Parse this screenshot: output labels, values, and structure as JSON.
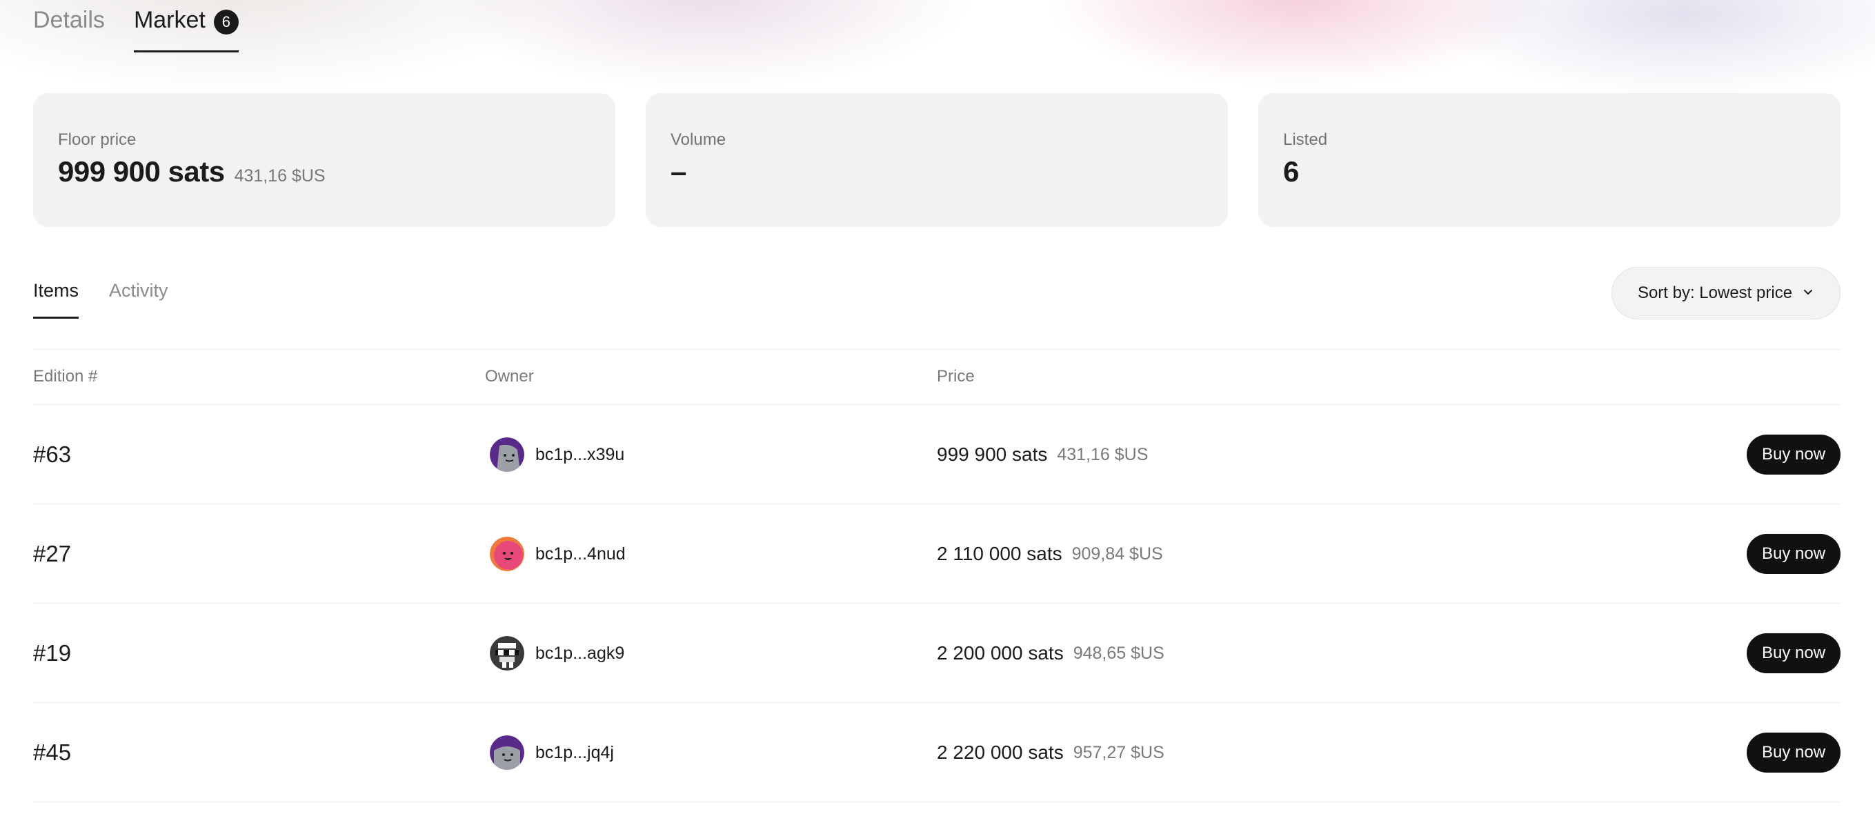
{
  "top_tabs": [
    {
      "label": "Details"
    },
    {
      "label": "Market",
      "badge": "6"
    }
  ],
  "stats": {
    "floor": {
      "label": "Floor price",
      "value": "999 900 sats",
      "usd": "431,16 $US"
    },
    "volume": {
      "label": "Volume",
      "value": "–"
    },
    "listed": {
      "label": "Listed",
      "value": "6"
    }
  },
  "sub_tabs": [
    {
      "label": "Items"
    },
    {
      "label": "Activity"
    }
  ],
  "sort": {
    "label": "Sort by: Lowest price"
  },
  "table": {
    "headers": {
      "edition": "Edition #",
      "owner": "Owner",
      "price": "Price"
    },
    "buy_label": "Buy now",
    "rows": [
      {
        "edition": "#63",
        "owner": "bc1p...x39u",
        "price_sats": "999 900 sats",
        "price_usd": "431,16 $US",
        "avatar_icon": "purple-grey-avatar-icon"
      },
      {
        "edition": "#27",
        "owner": "bc1p...4nud",
        "price_sats": "2 110 000 sats",
        "price_usd": "909,84 $US",
        "avatar_icon": "pink-orange-avatar-icon"
      },
      {
        "edition": "#19",
        "owner": "bc1p...agk9",
        "price_sats": "2 200 000 sats",
        "price_usd": "948,65 $US",
        "avatar_icon": "black-white-pixel-avatar-icon"
      },
      {
        "edition": "#45",
        "owner": "bc1p...jq4j",
        "price_sats": "2 220 000 sats",
        "price_usd": "957,27 $US",
        "avatar_icon": "purple-grey-avatar-icon"
      }
    ]
  },
  "colors": {
    "accent": "#1b1b1b",
    "button_bg": "#111111",
    "card_bg": "#f0f0f0"
  }
}
